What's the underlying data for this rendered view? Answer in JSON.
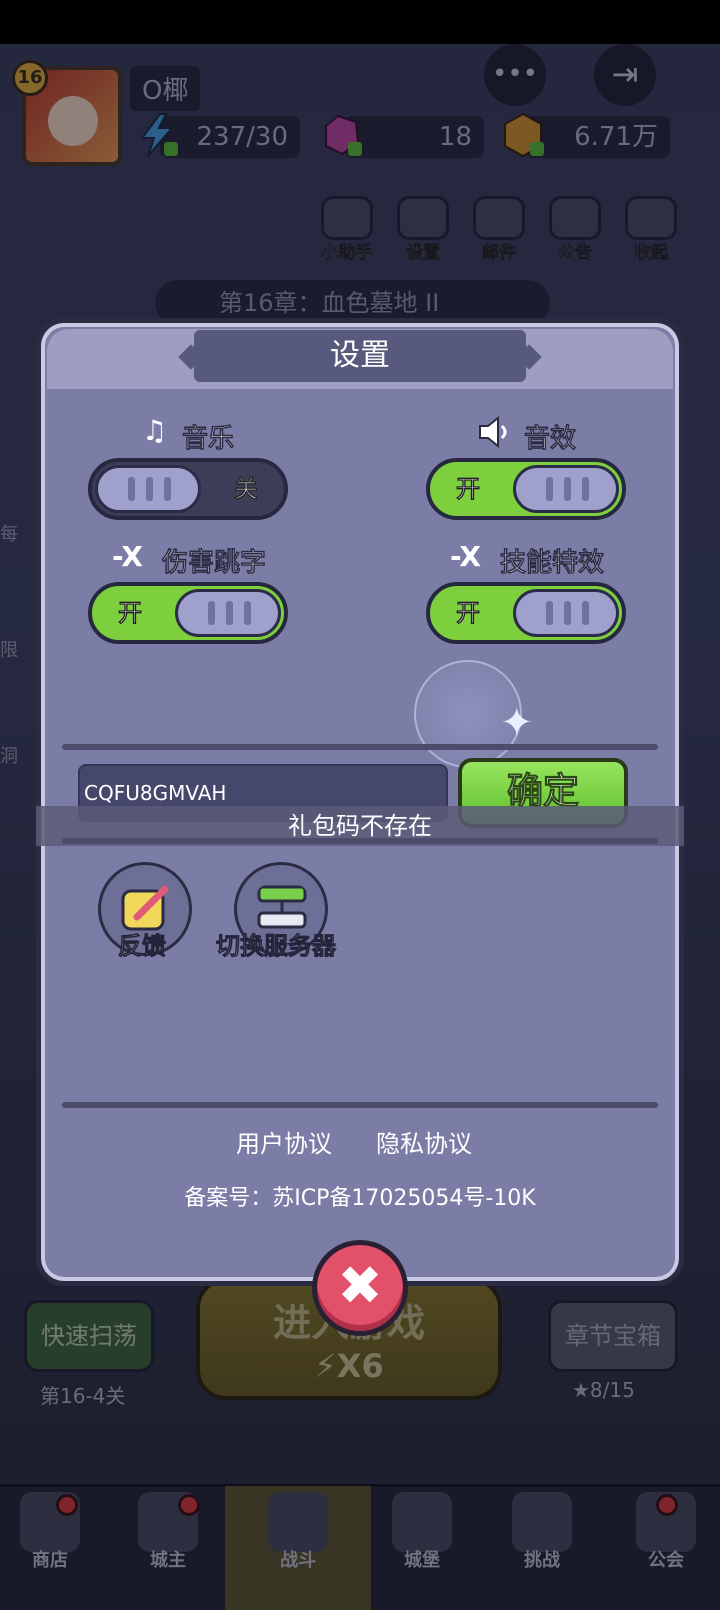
{
  "hud": {
    "level": "16",
    "player_name": "O椰",
    "energy": "237/30",
    "gems": "18",
    "coins": "6.71万",
    "more_icon": "•••",
    "exit_icon": "⇥"
  },
  "shortcuts": [
    {
      "label": "小助手",
      "icon": "robot-icon"
    },
    {
      "label": "设置",
      "icon": "gear-icon"
    },
    {
      "label": "邮件",
      "icon": "mail-icon"
    },
    {
      "label": "公告",
      "icon": "megaphone-icon"
    },
    {
      "label": "收起",
      "icon": "play-icon"
    }
  ],
  "chapter": "第16章：血色墓地 II",
  "side": {
    "left_items": [
      "每",
      "限",
      "洞"
    ]
  },
  "bottom": {
    "quick_sweep": "快速扫荡",
    "quick_sweep_sub": "第16-4关",
    "enter_game": "进入游戏",
    "enter_cost": "⚡X6",
    "chapter_chest": "章节宝箱",
    "chapter_chest_sub": "★8/15"
  },
  "navbar": [
    {
      "label": "商店"
    },
    {
      "label": "城主"
    },
    {
      "label": "战斗"
    },
    {
      "label": "城堡"
    },
    {
      "label": "挑战"
    },
    {
      "label": "公会"
    }
  ],
  "settings": {
    "title": "设置",
    "music_label": "音乐",
    "music_state": "关",
    "sound_label": "音效",
    "sound_state": "开",
    "damage_label": "伤害跳字",
    "damage_state": "开",
    "skill_label": "技能特效",
    "skill_state": "开",
    "gift_code_value": "CQFU8GMVAH",
    "confirm_label": "确定",
    "toast": "礼包码不存在",
    "feedback_label": "反馈",
    "switch_server_label": "切换服务器",
    "user_agreement": "用户协议",
    "privacy_policy": "隐私协议",
    "icp": "备案号：苏ICP备17025054号-10K",
    "close_icon": "✖"
  },
  "colors": {
    "dialog_bg": "#7b7da6",
    "toggle_on": "#7ecf3e",
    "toggle_off": "#3c3e58",
    "confirm_green": "#5fbf2c",
    "close_red": "#e2506a"
  }
}
